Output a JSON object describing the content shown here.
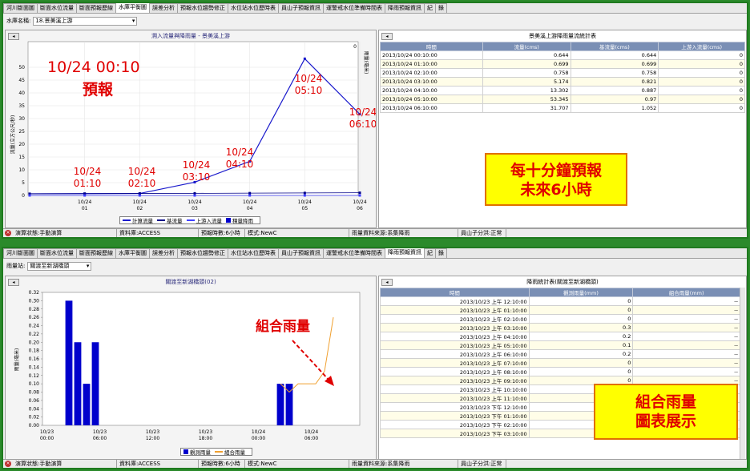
{
  "top": {
    "tabs": [
      "河川斷面圖",
      "斷面水位流量",
      "斷面預報歷線",
      "水庫平衡圖",
      "誤差分析",
      "預報水位趨勢修正",
      "水位站水位歷時表",
      "員山子預報資訊",
      "運警戒水位準備時間表",
      "降雨預報資訊",
      "紀",
      "錄"
    ],
    "active_tab_index": 3,
    "filter_label": "水庫名稱:",
    "filter_value": "18.景美溪上游",
    "chart_title": "溯入流量與降雨量 - 景美溪上游",
    "table_title": "景美溪上游降雨量流統計表",
    "table_headers": [
      "時間",
      "流量(cms)",
      "基流量(cms)",
      "上游入流量(cms)"
    ],
    "table_rows": [
      [
        "2013/10/24 00:10:00",
        "0.644",
        "0.644",
        "0"
      ],
      [
        "2013/10/24 01:10:00",
        "0.699",
        "0.699",
        "0"
      ],
      [
        "2013/10/24 02:10:00",
        "0.758",
        "0.758",
        "0"
      ],
      [
        "2013/10/24 03:10:00",
        "5.174",
        "0.821",
        "0"
      ],
      [
        "2013/10/24 04:10:00",
        "13.302",
        "0.887",
        "0"
      ],
      [
        "2013/10/24 05:10:00",
        "53.345",
        "0.97",
        "0"
      ],
      [
        "2013/10/24 06:10:00",
        "31.707",
        "1.052",
        "0"
      ]
    ],
    "big_label_time": "10/24 00:10",
    "big_label_word": "預報",
    "point_labels": [
      {
        "date": "10/24",
        "time": "01:10"
      },
      {
        "date": "10/24",
        "time": "02:10"
      },
      {
        "date": "10/24",
        "time": "03:10"
      },
      {
        "date": "10/24",
        "time": "04:10"
      },
      {
        "date": "10/24",
        "time": "05:10"
      },
      {
        "date": "10/24",
        "time": "06:10"
      }
    ],
    "callout_line1": "每十分鐘預報",
    "callout_line2": "未來6小時",
    "legend": [
      "計算流量",
      "基流量",
      "上游入流量",
      "積量降雨"
    ],
    "ylabel": "流量(立方公尺/秒)",
    "y2label": "雨量(毫米)",
    "y2_tick": "0",
    "status": [
      "演算狀態:手動演算",
      "資料庫:ACCESS",
      "預報時數:6小時",
      "模式:NewC",
      "雨量資料來源:系集降雨",
      "員山子分洪:正常"
    ]
  },
  "bottom": {
    "tabs": [
      "河川斷面圖",
      "斷面水位流量",
      "斷面預報歷線",
      "水庫平衡圖",
      "誤差分析",
      "預報水位趨勢修正",
      "水位站水位歷時表",
      "員山子預報資訊",
      "運警戒水位準備時間表",
      "降雨預報資訊",
      "紀",
      "錄"
    ],
    "active_tab_index": 9,
    "filter_label": "雨量站:",
    "filter_value": "關渡至新湖橋頭",
    "chart_title": "關渡至新湖橋頭(02)",
    "table_title": "降雨統計表(關渡至新湖橋頭)",
    "table_headers": [
      "時間",
      "觀測雨量(mm)",
      "組合雨量(mm)"
    ],
    "table_rows": [
      [
        "2013/10/23 上午 12:10:00",
        "0",
        "--"
      ],
      [
        "2013/10/23 上午 01:10:00",
        "0",
        "--"
      ],
      [
        "2013/10/23 上午 02:10:00",
        "0",
        "--"
      ],
      [
        "2013/10/23 上午 03:10:00",
        "0.3",
        "--"
      ],
      [
        "2013/10/23 上午 04:10:00",
        "0.2",
        "--"
      ],
      [
        "2013/10/23 上午 05:10:00",
        "0.1",
        "--"
      ],
      [
        "2013/10/23 上午 06:10:00",
        "0.2",
        "--"
      ],
      [
        "2013/10/23 上午 07:10:00",
        "0",
        "--"
      ],
      [
        "2013/10/23 上午 08:10:00",
        "0",
        "--"
      ],
      [
        "2013/10/23 上午 09:10:00",
        "0",
        "--"
      ],
      [
        "2013/10/23 上午 10:10:00",
        "0",
        "--"
      ],
      [
        "2013/10/23 上午 11:10:00",
        "0",
        "--"
      ],
      [
        "2013/10/23 下午 12:10:00",
        "0",
        "--"
      ],
      [
        "2013/10/23 下午 01:10:00",
        "0",
        "--"
      ],
      [
        "2013/10/23 下午 02:10:00",
        "0",
        "--"
      ],
      [
        "2013/10/23 下午 03:10:00",
        "0",
        "--"
      ]
    ],
    "annot": "組合雨量",
    "callout_line1": "組合雨量",
    "callout_line2": "圖表展示",
    "legend": [
      "觀測雨量",
      "組合雨量"
    ],
    "ylabel": "雨量(毫米)",
    "status": [
      "演算狀態:手動演算",
      "資料庫:ACCESS",
      "預報時數:6小時",
      "模式:NewC",
      "雨量資料來源:系集降雨",
      "員山子分洪:正常"
    ]
  },
  "chart_data": [
    {
      "type": "line",
      "x": [
        "10/24 00:10",
        "10/24 01:10",
        "10/24 02:10",
        "10/24 03:10",
        "10/24 04:10",
        "10/24 05:10",
        "10/24 06:10"
      ],
      "series": [
        {
          "name": "計算流量",
          "values": [
            0.644,
            0.699,
            0.758,
            5.174,
            13.302,
            53.345,
            31.707
          ]
        },
        {
          "name": "基流量",
          "values": [
            0.644,
            0.699,
            0.758,
            0.821,
            0.887,
            0.97,
            1.052
          ]
        },
        {
          "name": "上游入流量",
          "values": [
            0,
            0,
            0,
            0,
            0,
            0,
            0
          ]
        }
      ],
      "x_tick_labels": [
        [
          "10/24",
          "01"
        ],
        [
          "10/24",
          "02"
        ],
        [
          "10/24",
          "03"
        ],
        [
          "10/24",
          "04"
        ],
        [
          "10/24",
          "05"
        ],
        [
          "10/24",
          "06"
        ]
      ],
      "y_ticks": [
        0,
        5,
        10,
        15,
        20,
        25,
        30,
        35,
        40,
        45,
        50
      ],
      "ylabel": "流量(立方公尺/秒)",
      "ylim": [
        0,
        60
      ],
      "grid": true,
      "legend_position": "bottom"
    },
    {
      "type": "bar",
      "x_tick_labels": [
        [
          "10/23",
          "00:00"
        ],
        [
          "10/23",
          "06:00"
        ],
        [
          "10/23",
          "12:00"
        ],
        [
          "10/23",
          "18:00"
        ],
        [
          "10/24",
          "00:00"
        ],
        [
          "10/24",
          "06:00"
        ]
      ],
      "series": [
        {
          "name": "觀測雨量",
          "values": [
            0.3,
            0.2,
            0.1,
            0.2,
            0.1,
            0.1
          ]
        },
        {
          "name": "組合雨量",
          "values": [
            0.1,
            0.08,
            0.1,
            0.1,
            0.1,
            0.13,
            0.26
          ]
        }
      ],
      "bar_hours": [
        3,
        4,
        5,
        6,
        27,
        28
      ],
      "line_hours": [
        27,
        28,
        29,
        30,
        31,
        32,
        33
      ],
      "y_ticks": [
        0,
        0.02,
        0.04,
        0.06,
        0.08,
        0.1,
        0.12,
        0.14,
        0.16,
        0.18,
        0.2,
        0.22,
        0.24,
        0.26,
        0.28,
        0.3,
        0.32
      ],
      "ylabel": "雨量(毫米)",
      "ylim": [
        0,
        0.32
      ],
      "xlim_hours": [
        0,
        36
      ],
      "grid": false,
      "legend_position": "bottom"
    }
  ]
}
